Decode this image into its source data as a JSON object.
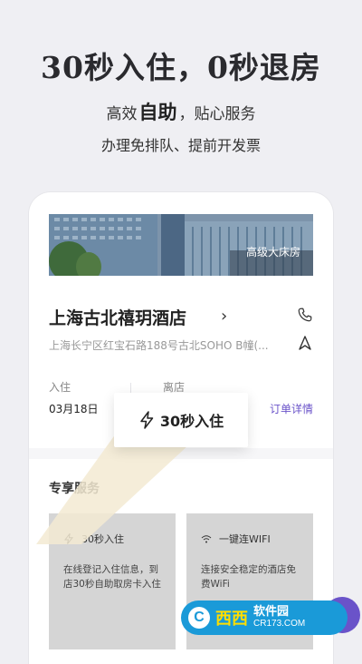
{
  "hero": {
    "title": "30秒入住，0秒退房",
    "sub1_pre": "高效",
    "sub1_bold": "自助",
    "sub1_post": "，贴心服务",
    "sub2": "办理免排队、提前开发票"
  },
  "hotel": {
    "room_tag": "高级大床房",
    "name": "上海古北禧玥酒店",
    "address": "上海长宁区红宝石路188号古北SOHO B幢(...",
    "checkin_label": "入住",
    "checkin_date": "03月18日",
    "checkout_label": "离店",
    "order_link": "订单详情"
  },
  "quick_checkin": {
    "label": "30秒入住"
  },
  "services": {
    "title": "专享服务",
    "items": [
      {
        "title": "30秒入住",
        "desc": "在线登记入住信息，到店30秒自助取房卡入住",
        "icon": "lightning-icon"
      },
      {
        "title": "一键连WIFI",
        "desc": "连接安全稳定的酒店免费WiFi",
        "icon": "wifi-icon"
      }
    ]
  },
  "watermark": {
    "main": "西西",
    "r1": "软件园",
    "r2": "CR173.COM"
  },
  "colors": {
    "accent": "#6a53c9",
    "background": "#efeff3",
    "beam": "#f6edd8"
  }
}
